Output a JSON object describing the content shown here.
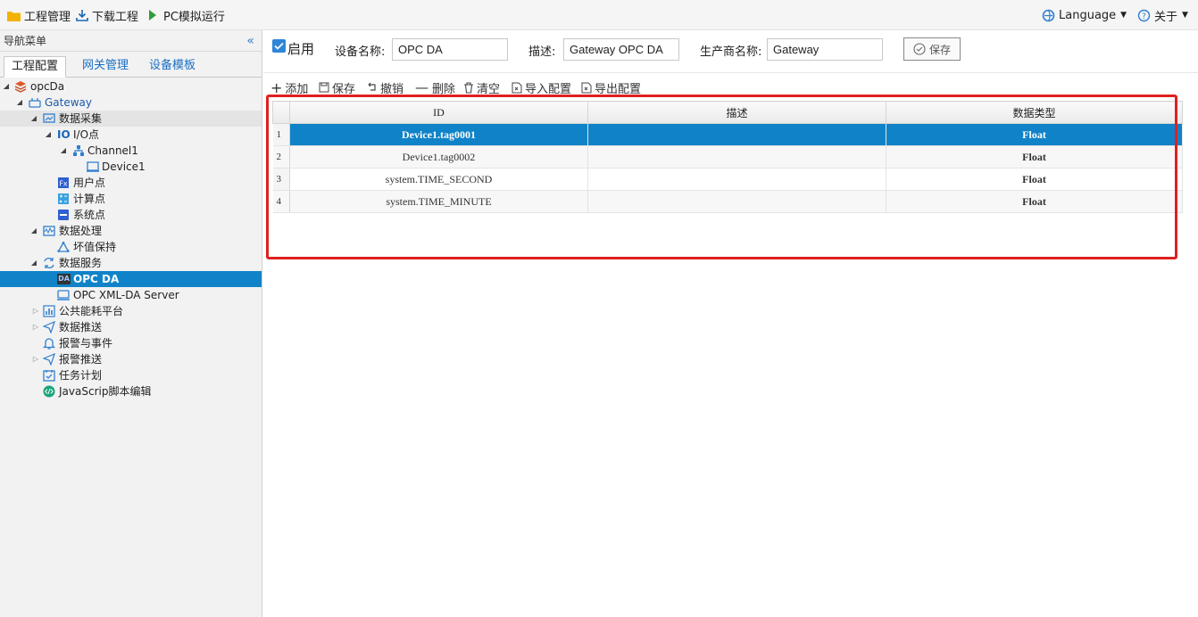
{
  "topbar": {
    "project_mgmt": "工程管理",
    "download_project": "下载工程",
    "pc_sim_run": "PC模拟运行",
    "language": "Language",
    "about": "关于"
  },
  "sidebar": {
    "header": "导航菜单",
    "tabs": [
      "工程配置",
      "网关管理",
      "设备模板"
    ],
    "tree": {
      "opcda": "opcDa",
      "gateway": "Gateway",
      "data_collection": "数据采集",
      "io_points": "I/O点",
      "channel1": "Channel1",
      "device1": "Device1",
      "user_points": "用户点",
      "calc_points": "计算点",
      "system_points": "系统点",
      "data_processing": "数据处理",
      "bad_value_hold": "坏值保持",
      "data_service": "数据服务",
      "opc_da": "OPC DA",
      "opc_xml_da": "OPC XML-DA Server",
      "public_energy": "公共能耗平台",
      "data_push": "数据推送",
      "alarm_event": "报警与事件",
      "alarm_push": "报警推送",
      "task_plan": "任务计划",
      "js_editor": "JavaScrip脚本编辑"
    }
  },
  "form": {
    "enable_label": "启用",
    "device_name_label": "设备名称:",
    "device_name_value": "OPC DA",
    "desc_label": "描述:",
    "desc_value": "Gateway OPC DA",
    "vendor_label": "生产商名称:",
    "vendor_value": "Gateway",
    "save": "保存"
  },
  "toolbar": {
    "add": "添加",
    "save": "保存",
    "undo": "撤销",
    "delete": "删除",
    "clear": "清空",
    "import": "导入配置",
    "export": "导出配置"
  },
  "grid": {
    "headers": [
      "ID",
      "描述",
      "数据类型"
    ],
    "rows": [
      {
        "n": "1",
        "id": "Device1.tag0001",
        "desc": "",
        "type": "Float"
      },
      {
        "n": "2",
        "id": "Device1.tag0002",
        "desc": "",
        "type": "Float"
      },
      {
        "n": "3",
        "id": "system.TIME_SECOND",
        "desc": "",
        "type": "Float"
      },
      {
        "n": "4",
        "id": "system.TIME_MINUTE",
        "desc": "",
        "type": "Float"
      }
    ]
  }
}
